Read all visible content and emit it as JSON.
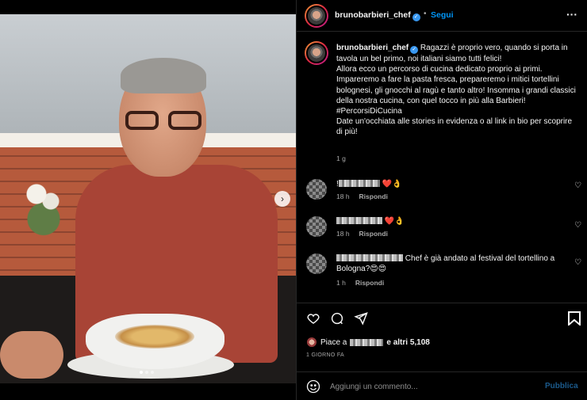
{
  "post": {
    "username": "brunobarbieri_chef",
    "follow_label": "Segui",
    "separator": "•",
    "more_icon": "more-horizontal-icon",
    "caption_lines": [
      "Ragazzi è proprio vero, quando si porta in tavola un bel primo, noi italiani siamo tutti felici!",
      "Allora ecco un percorso di cucina dedicato proprio ai primi. Impareremo a fare la pasta fresca, prepareremo i mitici tortellini bolognesi, gli gnocchi al ragù e tanto altro! Insomma i grandi classici della nostra cucina, con quel tocco in più alla Barbieri!",
      "#PercorsiDiCucina",
      "Date un'occhiata alle stories in evidenza o al link in bio per scoprire di più!"
    ],
    "caption_time": "1 g",
    "next_arrow": "›"
  },
  "comments": [
    {
      "text_prefix": "!",
      "text": "❤️👌",
      "time": "18 h",
      "reply": "Rispondi"
    },
    {
      "text_prefix": "",
      "text": "❤️👌",
      "time": "18 h",
      "reply": "Rispondi"
    },
    {
      "text_prefix": "",
      "text": "Chef è già andato al festival del tortellino a Bologna?😍😍",
      "time": "1 h",
      "reply": "Rispondi"
    }
  ],
  "likes": {
    "prefix": "Piace a",
    "suffix": "e altri",
    "count": "5,108"
  },
  "date_label": "1 GIORNO FA",
  "add_comment": {
    "placeholder": "Aggiungi un commento...",
    "publish_label": "Pubblica"
  },
  "carousel": {
    "total": 3,
    "active": 1
  },
  "colors": {
    "accent": "#0095f6",
    "background": "#000000",
    "text": "#f5f5f5",
    "muted": "#a8a8a8"
  }
}
